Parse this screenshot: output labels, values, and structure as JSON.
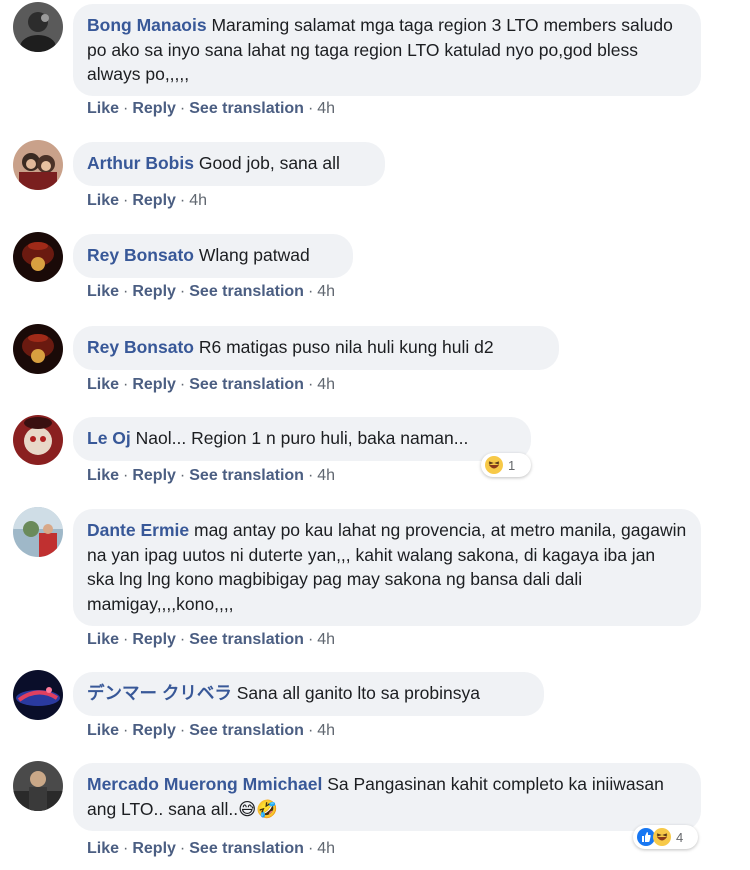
{
  "actions": {
    "like": "Like",
    "reply": "Reply",
    "see_translation": "See translation",
    "sep": "·"
  },
  "comments": [
    {
      "author": "Bong Manaois",
      "text": "Maraming salamat mga taga region 3 LTO members saludo po ako sa inyo sana lahat ng taga region LTO katulad nyo po,god bless always po,,,,,",
      "time": "4h"
    },
    {
      "author": "Arthur Bobis",
      "text": "Good job, sana all",
      "time": "4h"
    },
    {
      "author": "Rey Bonsato",
      "text": "Wlang patwad",
      "time": "4h"
    },
    {
      "author": "Rey Bonsato",
      "text": "R6 matigas puso nila huli kung huli d2",
      "time": "4h"
    },
    {
      "author": "Le Oj",
      "text": "Naol... Region 1 n puro huli, baka naman...",
      "time": "4h",
      "reaction_count": "1"
    },
    {
      "author": "Dante Ermie",
      "text": "mag antay po kau lahat ng provencia, at metro manila, gagawin na yan ipag uutos ni duterte yan,,, kahit walang sakona, di kagaya iba jan ska lng lng kono magbibigay pag may sakona ng bansa dali dali mamigay,,,,kono,,,,",
      "time": "4h"
    },
    {
      "author": "デンマー クリベラ",
      "text": "Sana all ganito lto sa probinsya",
      "time": "4h"
    },
    {
      "author": "Mercado Muerong Mmichael",
      "text": "Sa Pangasinan kahit completo ka iniiwasan ang LTO.. sana all..😅🤣",
      "time": "4h",
      "reaction_count": "4"
    }
  ],
  "colors": {
    "author": "#385898",
    "bubble": "#f0f2f5",
    "action": "#4b5e82"
  }
}
